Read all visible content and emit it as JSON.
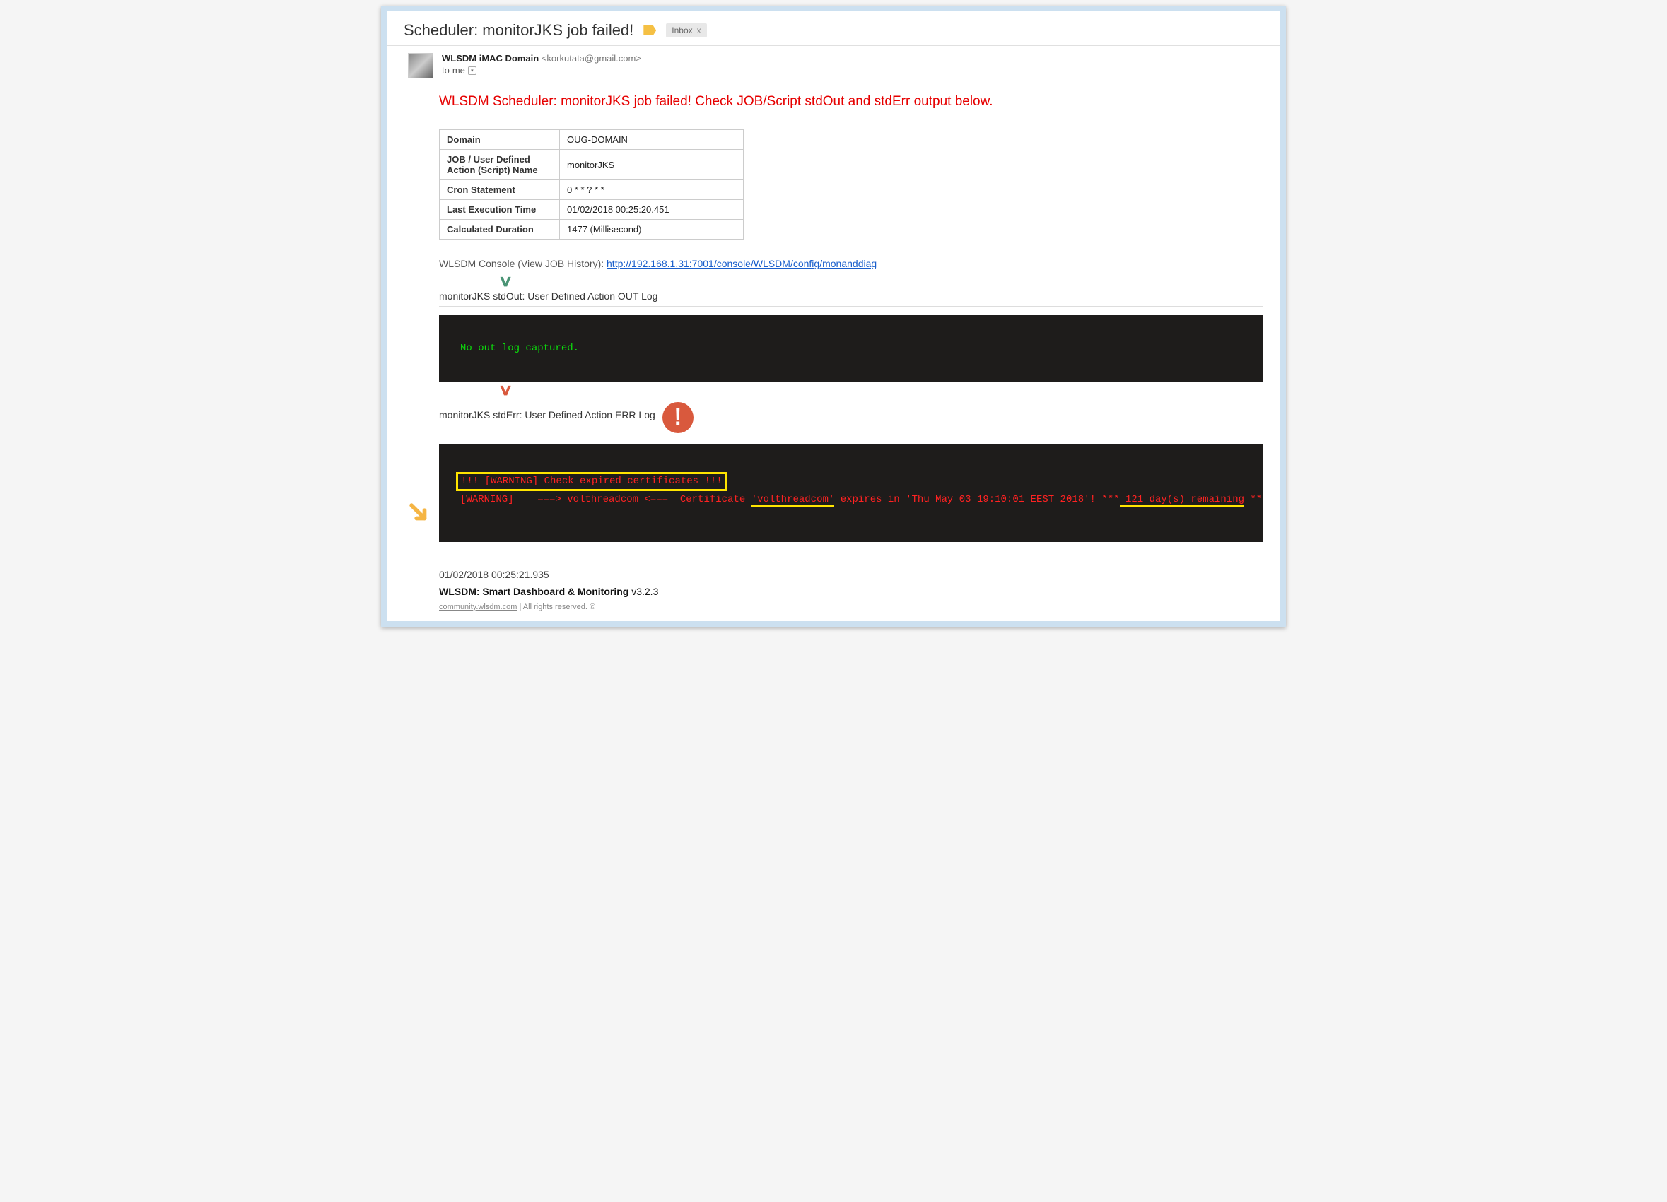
{
  "header": {
    "subject": "Scheduler: monitorJKS job failed!",
    "inbox_label": "Inbox",
    "inbox_close": "x"
  },
  "sender": {
    "name": "WLSDM iMAC Domain",
    "email": "<korkutata@gmail.com>",
    "to_prefix": "to",
    "to_target": "me"
  },
  "alert_title": "WLSDM Scheduler: monitorJKS job failed! Check JOB/Script stdOut and stdErr output below.",
  "info_table": {
    "rows": [
      {
        "k": "Domain",
        "v": "OUG-DOMAIN"
      },
      {
        "k": "JOB / User Defined Action (Script) Name",
        "v": "monitorJKS"
      },
      {
        "k": "Cron Statement",
        "v": "0 * * ? * *"
      },
      {
        "k": "Last Execution Time",
        "v": "01/02/2018 00:25:20.451"
      },
      {
        "k": "Calculated Duration",
        "v": "1477 (Millisecond)"
      }
    ]
  },
  "console_link": {
    "prefix": "WLSDM Console (View JOB History): ",
    "url": "http://192.168.1.31:7001/console/WLSDM/config/monanddiag"
  },
  "stdout": {
    "heading": "monitorJKS stdOut: User Defined Action OUT Log",
    "content": "No out log captured."
  },
  "stderr": {
    "heading": "monitorJKS stdErr: User Defined Action ERR Log",
    "line1": "!!! [WARNING] Check expired certificates !!!",
    "line2_a": "[WARNING]    ===> volthreadcom <===  Certificate ",
    "line2_cert": "'volthreadcom'",
    "line2_b": " expires in 'Thu May 03 19:10:01 EEST 2018'! ***",
    "line2_days": " 121 day(s) remaining",
    "line2_c": " ***"
  },
  "footer": {
    "timestamp": "01/02/2018 00:25:21.935",
    "product_bold": "WLSDM: Smart Dashboard & Monitoring",
    "product_ver": " v3.2.3",
    "legal_link": "community.wlsdm.com",
    "legal_rest": " | All rights reserved. ©"
  }
}
